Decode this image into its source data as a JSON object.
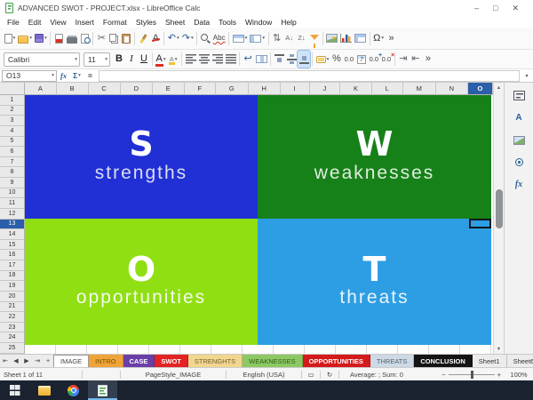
{
  "ui": {
    "dropdown": "▾",
    "scroll_up": "▲",
    "scroll_down": "▼"
  },
  "window": {
    "title": "ADVANCED SWOT - PROJECT.xlsx - LibreOffice Calc",
    "minimize": "–",
    "maximize": "□",
    "close": "✕"
  },
  "menu_items": [
    "File",
    "Edit",
    "View",
    "Insert",
    "Format",
    "Styles",
    "Sheet",
    "Data",
    "Tools",
    "Window",
    "Help"
  ],
  "toolbar_standard": [
    {
      "name": "new-document",
      "css": "ic-new",
      "dd": true
    },
    {
      "name": "open-file",
      "css": "ic-open",
      "dd": true
    },
    {
      "name": "save",
      "css": "ic-save",
      "dd": true
    },
    {
      "sep": true
    },
    {
      "name": "export-pdf",
      "css": "ic-pdf"
    },
    {
      "name": "print",
      "css": "ic-print"
    },
    {
      "name": "print-preview",
      "css": "ic-preview"
    },
    {
      "sep": true
    },
    {
      "name": "cut",
      "glyph": "✂",
      "color": "#5f6368"
    },
    {
      "name": "copy",
      "css": "ic-copy"
    },
    {
      "name": "paste",
      "css": "ic-paste"
    },
    {
      "sep": true
    },
    {
      "name": "clone-formatting",
      "css": "ic-clone"
    },
    {
      "name": "clear-formatting",
      "glyph": "A",
      "color": "#444",
      "cls": "strike-red"
    },
    {
      "sep": true
    },
    {
      "name": "undo",
      "glyph": "↶",
      "color": "#2a6099",
      "dd": true
    },
    {
      "name": "redo",
      "glyph": "↷",
      "color": "#2a6099",
      "dd": true
    },
    {
      "sep": true
    },
    {
      "name": "find-and-replace",
      "css": "ic-find"
    },
    {
      "name": "spelling",
      "glyph": "Abc",
      "color": "#444",
      "cls": "spellcheck"
    },
    {
      "sep": true
    },
    {
      "name": "insert-row",
      "css": "ic-row",
      "dd": true
    },
    {
      "name": "insert-column",
      "css": "ic-col",
      "dd": true
    },
    {
      "sep": true
    },
    {
      "name": "sort",
      "glyph": "⇅",
      "color": "#5f6368"
    },
    {
      "name": "sort-ascending",
      "glyph": "A↓",
      "color": "#5f6368",
      "cls": "small"
    },
    {
      "name": "sort-descending",
      "glyph": "Z↓",
      "color": "#5f6368",
      "cls": "small"
    },
    {
      "name": "autofilter",
      "css": "ic-filter"
    },
    {
      "sep": true
    },
    {
      "name": "insert-image",
      "css": "ic-image"
    },
    {
      "name": "insert-chart",
      "css": "ic-chart"
    },
    {
      "name": "insert-pivot-table",
      "css": "ic-pivot"
    },
    {
      "sep": true
    },
    {
      "name": "special-character",
      "glyph": "Ω",
      "color": "#333",
      "dd": true
    },
    {
      "name": "toolbar-overflow",
      "glyph": "»",
      "color": "#444"
    }
  ],
  "toolbar_formatting": [
    {
      "name": "font-name",
      "combo": true,
      "value": "Calibri",
      "width": 86
    },
    {
      "name": "font-size",
      "combo": true,
      "value": "11",
      "width": 30
    },
    {
      "name": "bold",
      "glyph": "B",
      "color": "#222",
      "cls": "b"
    },
    {
      "name": "italic",
      "glyph": "I",
      "color": "#222",
      "cls": "i serif"
    },
    {
      "name": "underline",
      "glyph": "U",
      "color": "#222",
      "cls": "u"
    },
    {
      "sep": true
    },
    {
      "name": "font-color",
      "glyph": "A",
      "color": "#222",
      "cls": "bar bar-red",
      "dd": true
    },
    {
      "name": "highlighting-color",
      "glyph": "A",
      "color": "#777",
      "cls": "small bar bar-yellow",
      "dd": true
    },
    {
      "sep": true
    },
    {
      "name": "align-left",
      "css": "ic-al ic-al-left"
    },
    {
      "name": "align-center",
      "css": "ic-al ic-al-center"
    },
    {
      "name": "align-right",
      "css": "ic-al ic-al-right"
    },
    {
      "name": "justified",
      "css": "ic-al ic-al-just"
    },
    {
      "sep": true
    },
    {
      "name": "wrap-text",
      "glyph": "↩",
      "color": "#2a6099"
    },
    {
      "name": "merge-cells",
      "css": "ic-merge"
    },
    {
      "sep": true
    },
    {
      "name": "align-top",
      "css": "ic-vt"
    },
    {
      "name": "center-vertically",
      "css": "ic-vc"
    },
    {
      "name": "align-bottom",
      "css": "ic-vb",
      "active": true
    },
    {
      "sep": true
    },
    {
      "name": "format-as-currency",
      "css": "ic-currency",
      "dd": true
    },
    {
      "name": "format-as-percent",
      "glyph": "%",
      "color": "#444"
    },
    {
      "name": "format-as-number",
      "glyph": "0.0",
      "color": "#444",
      "cls": "small"
    },
    {
      "name": "format-as-date",
      "css": "ic-date"
    },
    {
      "name": "add-decimal-place",
      "glyph": "0.0",
      "color": "#444",
      "cls": "small sup-plus"
    },
    {
      "name": "delete-decimal-place",
      "glyph": "0.0",
      "color": "#444",
      "cls": "small sup-x"
    },
    {
      "sep": true
    },
    {
      "name": "increase-indent",
      "glyph": "⇥",
      "color": "#5f6368"
    },
    {
      "name": "decrease-indent",
      "glyph": "⇤",
      "color": "#5f6368"
    },
    {
      "name": "toolbar-overflow",
      "glyph": "»",
      "color": "#444"
    }
  ],
  "formula_bar": {
    "cell_reference": "O13",
    "function_wizard": "fx",
    "sum": "Σ",
    "equals": "=",
    "input_value": ""
  },
  "grid": {
    "columns": [
      "A",
      "B",
      "C",
      "D",
      "E",
      "F",
      "G",
      "H",
      "I",
      "J",
      "K",
      "L",
      "M",
      "N",
      "O"
    ],
    "selected_column": "O",
    "row_count": 25,
    "selected_row": 13,
    "cursor_cell": "O13"
  },
  "swot_quadrants": [
    {
      "id": "strengths",
      "letter": "S",
      "label": "strengths",
      "bg": "#2030D4",
      "text_color": "#DDDCF5"
    },
    {
      "id": "weaknesses",
      "letter": "W",
      "label": "weaknesses",
      "bg": "#178119",
      "text_color": "#DFEDDD"
    },
    {
      "id": "opportunities",
      "letter": "O",
      "label": "opportunities",
      "bg": "#90DF12",
      "text_color": "#F2FBEA"
    },
    {
      "id": "threats",
      "letter": "T",
      "label": "threats",
      "bg": "#2D9EE3",
      "text_color": "#E8F4FC"
    }
  ],
  "sidebar": {
    "items": [
      {
        "name": "sidebar-settings",
        "css": "ic-props"
      },
      {
        "name": "styles",
        "glyph": "A",
        "cls": "b"
      },
      {
        "name": "gallery",
        "css": "ic-gal"
      },
      {
        "name": "navigator",
        "css": "ic-nav"
      },
      {
        "name": "functions",
        "glyph": "fx",
        "cls": "i b serif"
      }
    ]
  },
  "tab_navigation": [
    {
      "name": "first-sheet",
      "glyph": "⇤"
    },
    {
      "name": "previous-sheet",
      "glyph": "◀"
    },
    {
      "name": "next-sheet",
      "glyph": "▶"
    },
    {
      "name": "last-sheet",
      "glyph": "⇥"
    },
    {
      "name": "insert-sheet",
      "glyph": "+"
    }
  ],
  "sheet_tabs": [
    {
      "label": "IMAGE",
      "bg": "#ffffff",
      "fg": "#444444",
      "active": true
    },
    {
      "label": "INTRO",
      "bg": "#efa43a",
      "fg": "#7a5200"
    },
    {
      "label": "CASE",
      "bg": "#6a3fa8",
      "fg": "#ffffff",
      "bold": true
    },
    {
      "label": "SWOT",
      "bg": "#e32424",
      "fg": "#ffffff",
      "bold": true
    },
    {
      "label": "STRENGHTS",
      "bg": "#f3d68e",
      "fg": "#6f6134"
    },
    {
      "label": "WEAKNESSES",
      "bg": "#8cc963",
      "fg": "#335c1a"
    },
    {
      "label": "OPPORTUNITIES",
      "bg": "#d41a1a",
      "fg": "#ffffff",
      "bold": true
    },
    {
      "label": "THREATS",
      "bg": "#cdd9e5",
      "fg": "#55616e"
    },
    {
      "label": "CONCLUSION",
      "bg": "#141414",
      "fg": "#ffffff",
      "bold": true
    },
    {
      "label": "Sheet1",
      "bg": "",
      "fg": "#333333"
    },
    {
      "label": "Sheet6",
      "bg": "",
      "fg": "#333333"
    }
  ],
  "status_bar": {
    "sheet_info": "Sheet 1 of 11",
    "page_style": "PageStyle_IMAGE",
    "language": "English (USA)",
    "selection_mode_icon": "▭",
    "modified_icon": "↻",
    "stats": "Average: ; Sum: 0",
    "zoom_minus": "−",
    "zoom_plus": "+",
    "zoom_level": "100%"
  },
  "taskbar": {
    "apps": [
      {
        "name": "start",
        "icon": "win"
      },
      {
        "name": "file-explorer",
        "icon": "exp"
      },
      {
        "name": "chrome",
        "icon": "chrome"
      },
      {
        "name": "libreoffice-calc",
        "icon": "calcapp",
        "active": true
      }
    ]
  }
}
